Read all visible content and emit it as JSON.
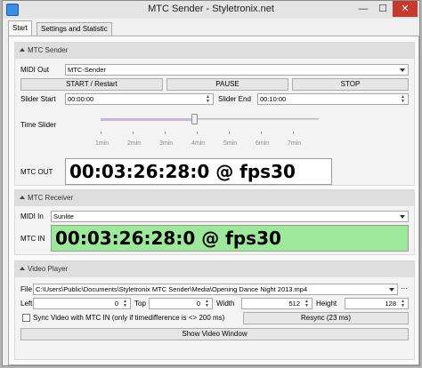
{
  "window": {
    "title": "MTC Sender - Styletronix.net",
    "min_glyph": "—",
    "max_glyph": "☐",
    "close_glyph": "✕"
  },
  "tabs": [
    {
      "label": "Start",
      "active": true
    },
    {
      "label": "Settings and Statistic",
      "active": false
    }
  ],
  "mtc_sender": {
    "title": "MTC Sender",
    "midi_out_label": "MIDI Out",
    "midi_out_value": "MTC-Sender",
    "start_label": "START / Restart",
    "pause_label": "PAUSE",
    "stop_label": "STOP",
    "slider_start_label": "Slider Start",
    "slider_start_value": "00:00:00",
    "slider_end_label": "Slider End",
    "slider_end_value": "00:10:00",
    "time_slider_label": "Time Slider",
    "time_slider_ticks": [
      "1min",
      "2min",
      "3min",
      "4min",
      "5min",
      "6min",
      "7min"
    ],
    "time_slider_position": 0.43,
    "mtc_out_label": "MTC OUT",
    "mtc_out_value": "00:03:26:28:0 @ fps30"
  },
  "mtc_receiver": {
    "title": "MTC Receiver",
    "midi_in_label": "MIDI In",
    "midi_in_value": "Sunlite",
    "mtc_in_label": "MTC IN",
    "mtc_in_value": "00:03:26:28:0 @ fps30",
    "mtc_in_color": "#9de89b"
  },
  "video_player": {
    "title": "Video Player",
    "file_label": "File",
    "file_value": "C:\\Users\\Public\\Documents\\Styletronix MTC Sender\\Media\\Opening Dance Night 2013.mp4",
    "left_label": "Left",
    "left_value": "0",
    "top_label": "Top",
    "top_value": "0",
    "width_label": "Width",
    "width_value": "512",
    "height_label": "Height",
    "height_value": "128",
    "sync_label": "Sync Video with MTC IN (only if timedifference is <> 200 ms)",
    "sync_checked": false,
    "resync_label": "Resync (23 ms)",
    "show_window_label": "Show Video Window"
  }
}
